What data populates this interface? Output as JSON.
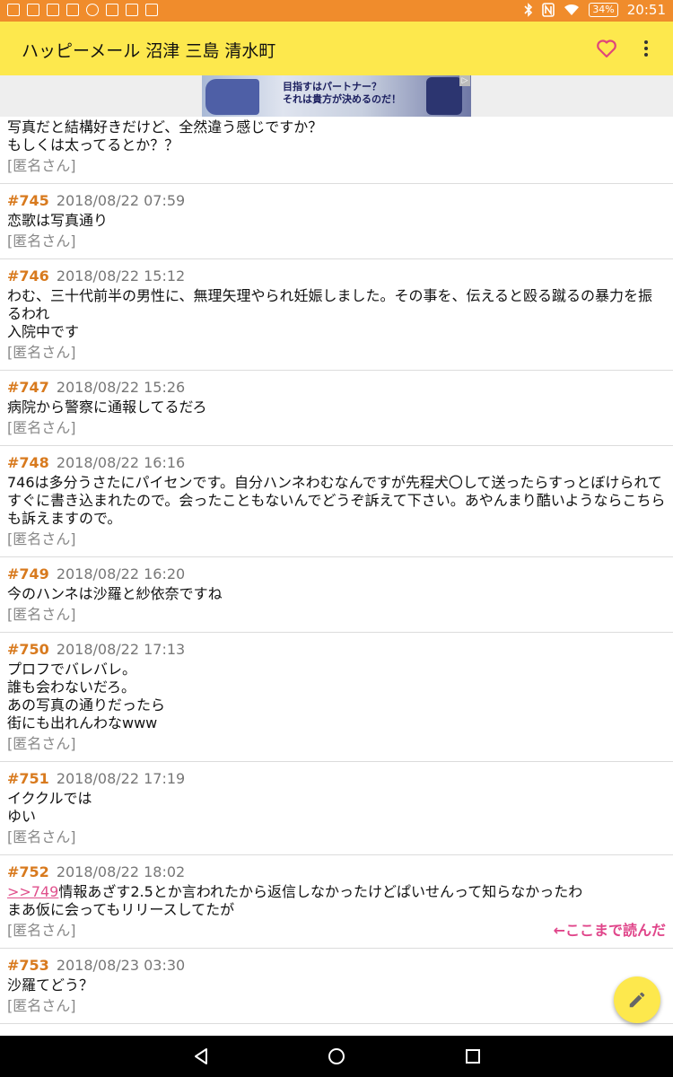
{
  "status_bar": {
    "time": "20:51",
    "battery": "34%",
    "icons_left": [
      "mail-icon",
      "calendar-icon",
      "notification-icon",
      "notification-icon",
      "chat-icon",
      "notification-icon",
      "notification-icon",
      "notification-icon"
    ],
    "icons_right": [
      "bluetooth-icon",
      "nfc-icon",
      "wifi-icon",
      "battery-icon"
    ]
  },
  "app_bar": {
    "title": "ハッピーメール 沼津 三島 清水町",
    "actions": [
      "heart-icon",
      "overflow-menu-icon"
    ],
    "background": "#fde84d"
  },
  "ad": {
    "line1": "目指すはパートナー？",
    "line2": "それは貴方が決めるのだ！"
  },
  "thread": {
    "first_partial": {
      "body": "写真だと結構好きだけど、全然違う感じですか？\nもしくは太ってるとか？？",
      "author": "[匿名さん]"
    },
    "posts": [
      {
        "num": "#745",
        "date": "2018/08/22 07:59",
        "body": "恋歌は写真通り",
        "author": "[匿名さん]"
      },
      {
        "num": "#746",
        "date": "2018/08/22 15:12",
        "body": "わむ、三十代前半の男性に、無理矢理やられ妊娠しました。その事を、伝えると殴る蹴るの暴力を振るわれ\n入院中です",
        "author": "[匿名さん]"
      },
      {
        "num": "#747",
        "date": "2018/08/22 15:26",
        "body": "病院から警察に通報してるだろ",
        "author": "[匿名さん]"
      },
      {
        "num": "#748",
        "date": "2018/08/22 16:16",
        "body": "746は多分うさたにパイセンです。自分ハンネわむなんですが先程犬〇して送ったらすっとぼけられてすぐに書き込まれたので。会ったこともないんでどうぞ訴えて下さい。あやんまり酷いようならこちらも訴えますので。",
        "author": "[匿名さん]"
      },
      {
        "num": "#749",
        "date": "2018/08/22 16:20",
        "body": "今のハンネは沙羅と紗依奈ですね",
        "author": "[匿名さん]"
      },
      {
        "num": "#750",
        "date": "2018/08/22 17:13",
        "body": "プロフでバレバレ。\n誰も会わないだろ。\nあの写真の通りだったら\n街にも出れんわなwww",
        "author": "[匿名さん]"
      },
      {
        "num": "#751",
        "date": "2018/08/22 17:19",
        "body": "イククルでは\nゆい",
        "author": "[匿名さん]"
      },
      {
        "num": "#752",
        "date": "2018/08/22 18:02",
        "quote": ">>749",
        "body": "情報あざす2.5とか言われたから返信しなかったけどぱいせんって知らなかったわ\nまあ仮に会ってもリリースしてたが",
        "author": "[匿名さん]",
        "read_marker": "←ここまで読んだ"
      },
      {
        "num": "#753",
        "date": "2018/08/23 03:30",
        "body": "沙羅てどう？",
        "author": "[匿名さん]"
      }
    ]
  },
  "fab": {
    "icon": "pencil-icon"
  },
  "nav_bar": {
    "buttons": [
      "back-icon",
      "home-icon",
      "recents-icon"
    ]
  },
  "colors": {
    "status_bar": "#f08c2c",
    "post_number": "#d87a1e",
    "read_marker": "#e0458a",
    "quote_link": "#e0508c"
  }
}
